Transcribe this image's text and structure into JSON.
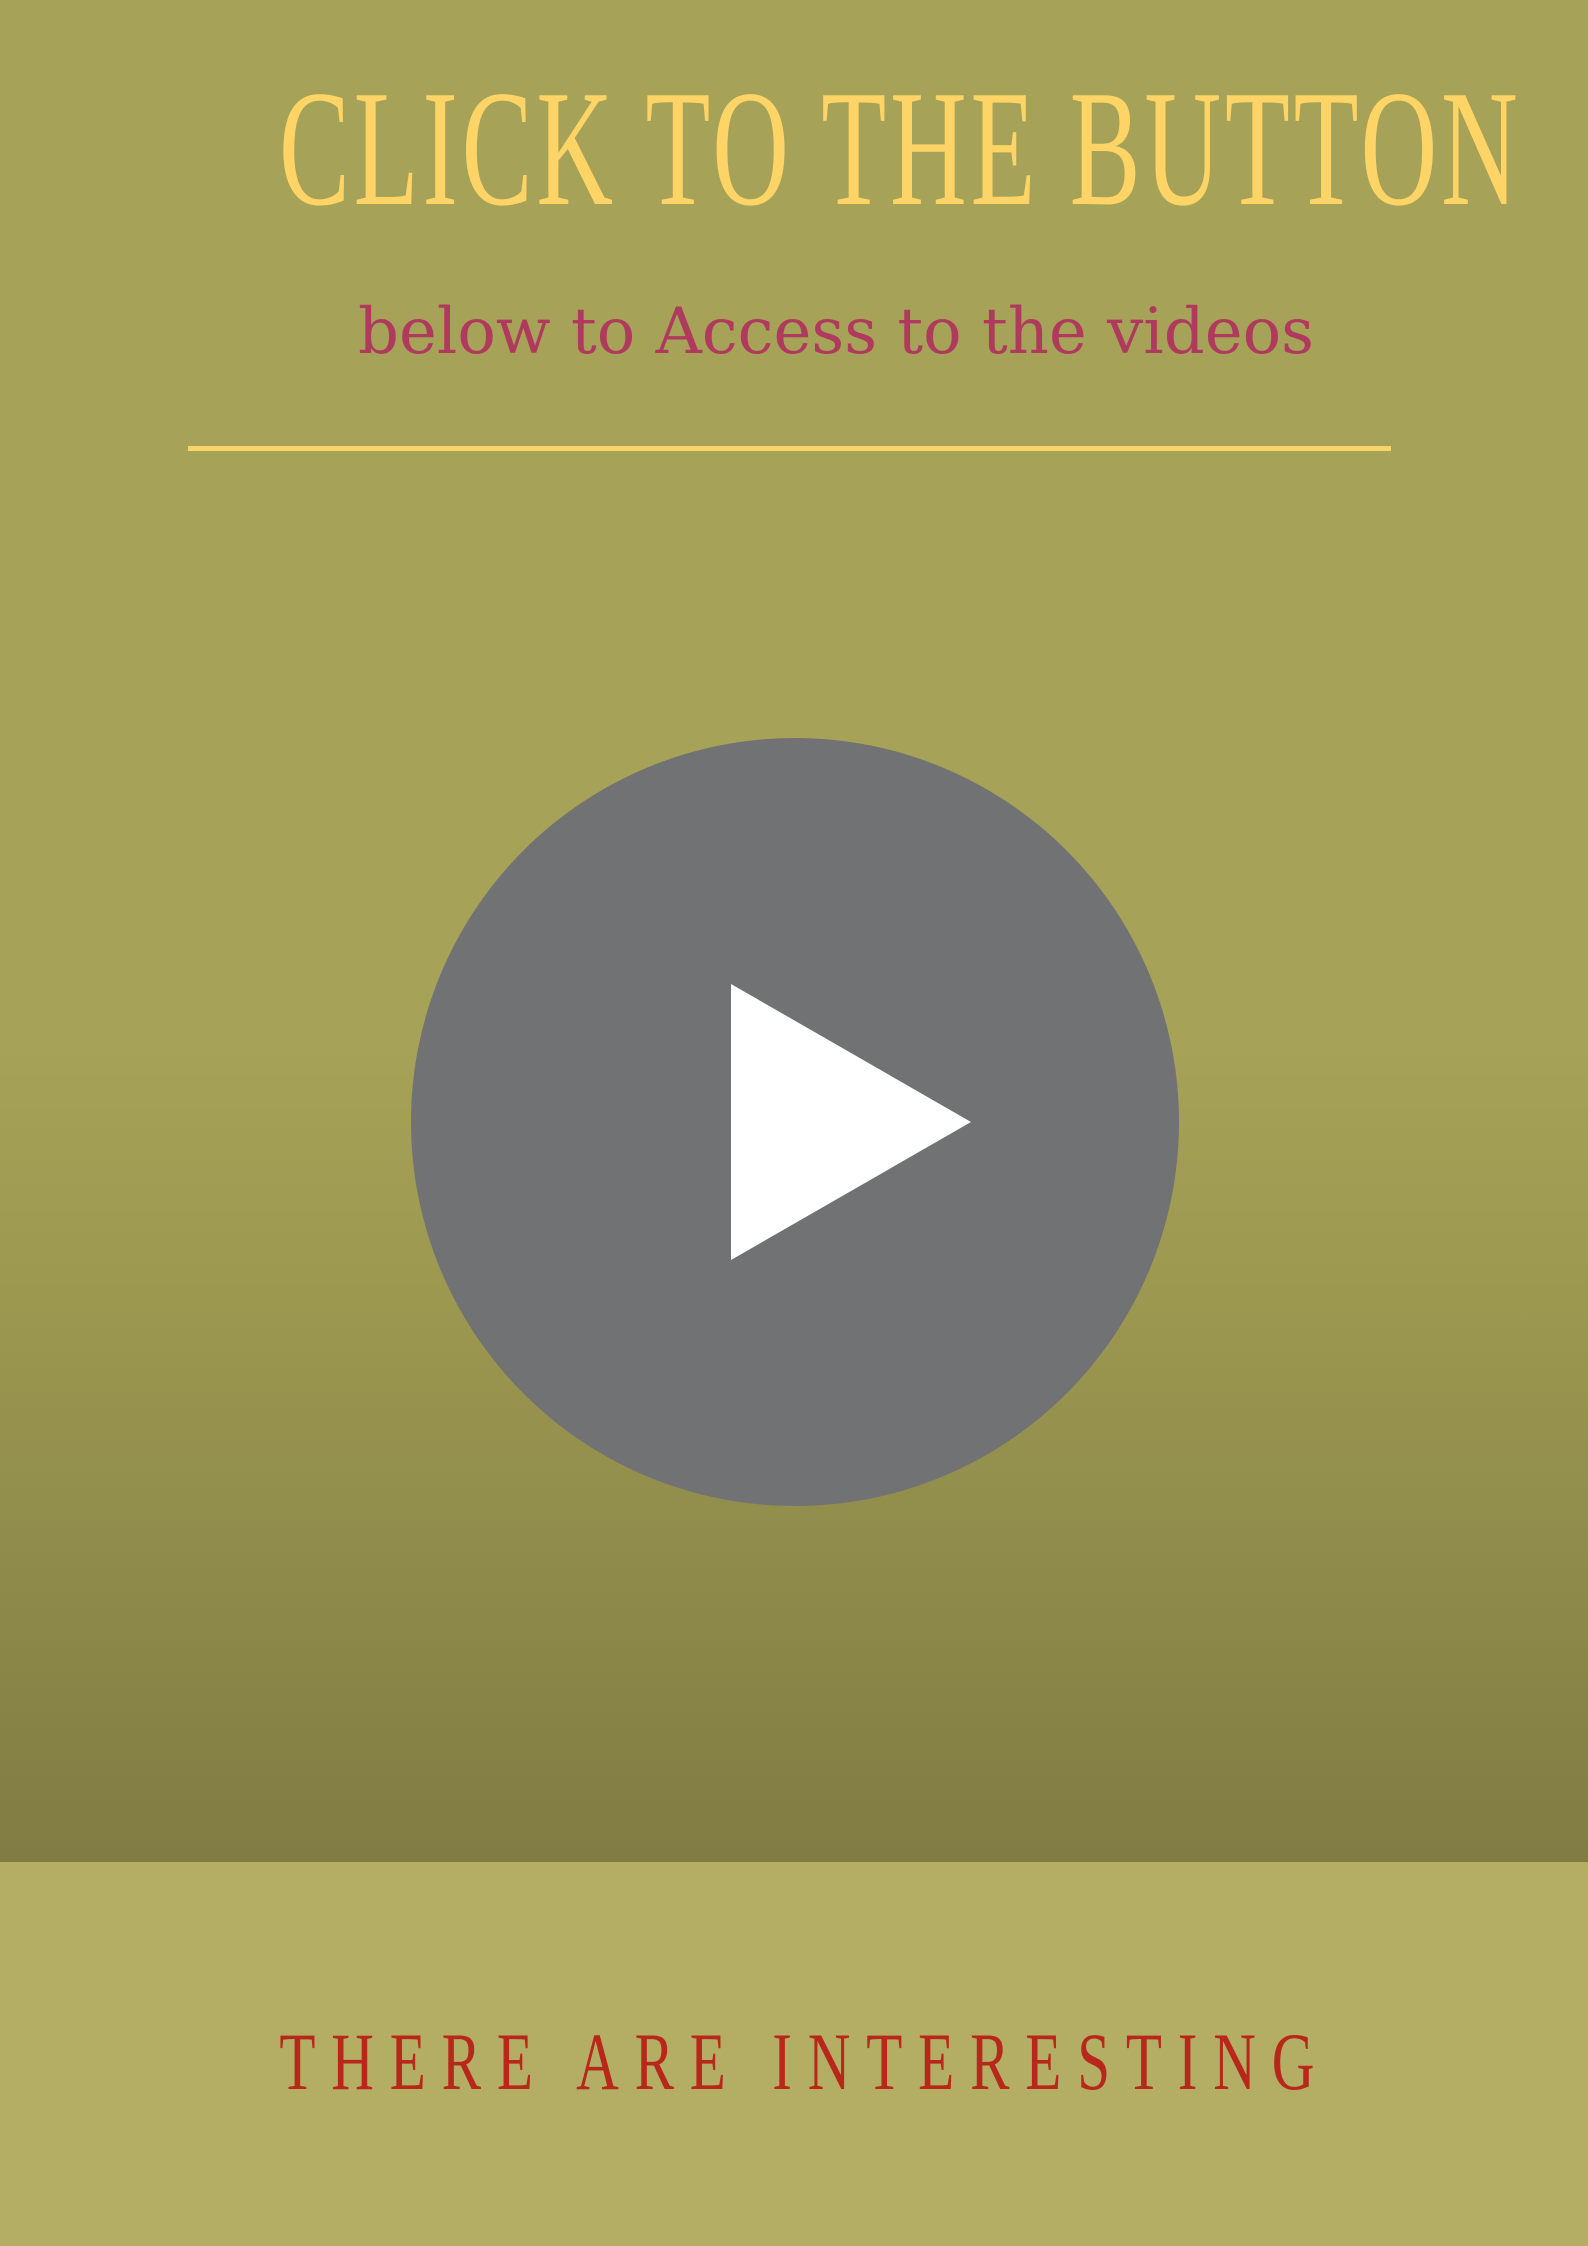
{
  "header": {
    "title": "CLICK TO THE BUTTON",
    "subtitle": "below to Access to the videos"
  },
  "play_button": {
    "icon": "play-icon",
    "background_color": "#707273",
    "icon_color": "#ffffff"
  },
  "footer": {
    "tagline": "THERE ARE INTERESTING"
  },
  "colors": {
    "background": "#a6a257",
    "background_bottom": "#807c43",
    "footer_band": "#b4ad64",
    "title": "#fdd465",
    "subtitle": "#b03a5e",
    "divider": "#f8d566",
    "tagline": "#b8271a"
  }
}
